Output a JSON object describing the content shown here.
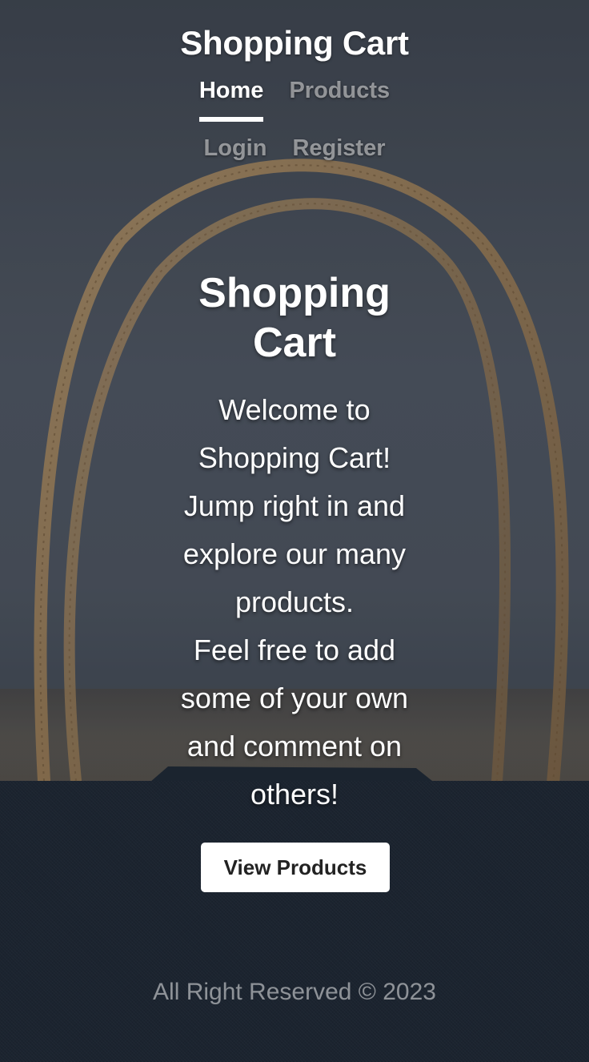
{
  "header": {
    "brand": "Shopping Cart"
  },
  "nav": {
    "items": [
      {
        "label": "Home",
        "active": true
      },
      {
        "label": "Products",
        "active": false
      },
      {
        "label": "Login",
        "active": false
      },
      {
        "label": "Register",
        "active": false
      }
    ]
  },
  "hero": {
    "title": "Shopping Cart",
    "paragraph1": "Welcome to Shopping Cart! Jump right in and explore our many products.",
    "paragraph2": "Feel free to add some of your own and comment on others!",
    "button_label": "View Products"
  },
  "footer": {
    "text": "All Right Reserved © 2023"
  },
  "colors": {
    "background": "#474e58",
    "bag_front": "#1c2530",
    "handle": "#a8865a",
    "button_bg": "#ffffff",
    "button_text": "#222222",
    "nav_inactive": "rgba(255,255,255,0.5)"
  }
}
